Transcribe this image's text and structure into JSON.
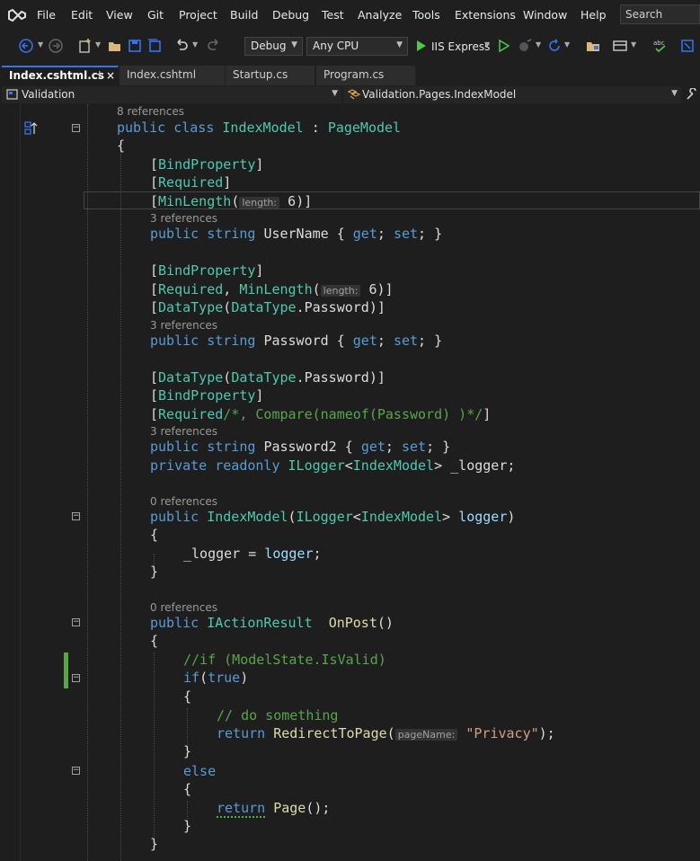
{
  "menubar": {
    "items": [
      "File",
      "Edit",
      "View",
      "Git",
      "Project",
      "Build",
      "Debug",
      "Test",
      "Analyze",
      "Tools",
      "Extensions",
      "Window",
      "Help"
    ],
    "search_label": "Search"
  },
  "toolbar": {
    "configuration": "Debug",
    "platform": "Any CPU",
    "run_label": "IIS Express"
  },
  "tabs": [
    {
      "label": "Index.cshtml.cs",
      "active": true
    },
    {
      "label": "Index.cshtml",
      "active": false
    },
    {
      "label": "Startup.cs",
      "active": false
    },
    {
      "label": "Program.cs",
      "active": false
    }
  ],
  "navbar": {
    "project": "Validation",
    "class_path": "Validation.Pages.IndexModel"
  },
  "code": {
    "refs_8": "8 references",
    "refs_3a": "3 references",
    "refs_3b": "3 references",
    "refs_3c": "3 references",
    "refs_0a": "0 references",
    "refs_0b": "0 references",
    "hint_length": "length:",
    "hint_pagename": "pageName:",
    "text": {
      "public": "public",
      "class": "class",
      "IndexModel": "IndexModel",
      "colon": " : ",
      "PageModel": "PageModel",
      "open_brace": "{",
      "close_brace": "}",
      "BindProperty": "BindProperty",
      "Required": "Required",
      "MinLength": "MinLength",
      "six": " 6",
      "string": "string",
      "UserName": "UserName",
      "get": "get",
      "set": "set",
      "Password": "Password",
      "DataType": "DataType",
      "Password2": "Password2",
      "compare_comment": "/*, Compare(nameof(Password) )*/",
      "private": "private",
      "readonly": "readonly",
      "ILogger": "ILogger",
      "_logger": "_logger",
      "logger": "logger",
      "IActionResult": "IActionResult",
      "OnPost": "OnPost",
      "if_comment": "//if (ModelState.IsValid)",
      "if": "if",
      "true": "true",
      "do_something": "// do something",
      "return": "return",
      "RedirectToPage": "RedirectToPage",
      "privacy": "\"Privacy\"",
      "else": "else",
      "Page": "Page"
    }
  },
  "colors": {
    "keyword": "#569cd6",
    "type": "#4ec9b0",
    "comment": "#57a64a",
    "string": "#d69d85",
    "method": "#dcdcaa",
    "parameter": "#9cdcfe",
    "accent": "#3574f0"
  },
  "icons": [
    "visual-studio-logo",
    "back-icon",
    "forward-icon",
    "new-project-icon",
    "open-icon",
    "save-icon",
    "save-all-icon",
    "undo-icon",
    "redo-icon",
    "run-icon",
    "start-without-debug-icon",
    "hot-reload-icon",
    "refresh-icon",
    "folder-icon",
    "layout-icon",
    "spell-check-icon",
    "wrench-icon",
    "sort-icon"
  ]
}
